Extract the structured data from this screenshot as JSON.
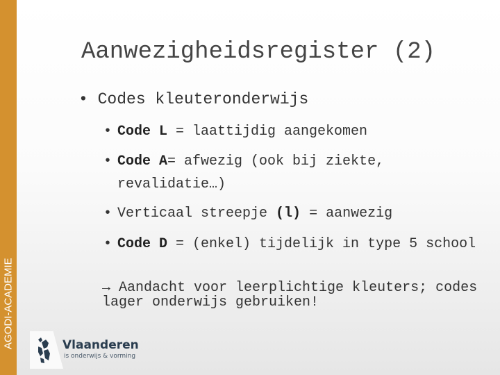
{
  "sidebar": {
    "label": "AGODI-ACADEMIE",
    "color": "#d4912f"
  },
  "title": "Aanwezigheidsregister (2)",
  "bullet": "Codes kleuteronderwijs",
  "items": [
    {
      "code": "Code L",
      "text": " = laattijdig aangekomen"
    },
    {
      "code": "Code A",
      "text": "= afwezig (ook bij ziekte,",
      "cont": "revalidatie…)"
    },
    {
      "pre": "Verticaal streepje ",
      "code": "(l)",
      "text": " = aanwezig"
    },
    {
      "code": "Code D",
      "text": " = (enkel) tijdelijk in type 5 school"
    }
  ],
  "note": {
    "line1": "→ Aandacht voor leerplichtige kleuters; codes",
    "line2": "lager onderwijs gebruiken!"
  },
  "logo": {
    "name": "Vlaanderen",
    "tagline": "is onderwijs & vorming",
    "icon": "flemish-lion-icon"
  }
}
